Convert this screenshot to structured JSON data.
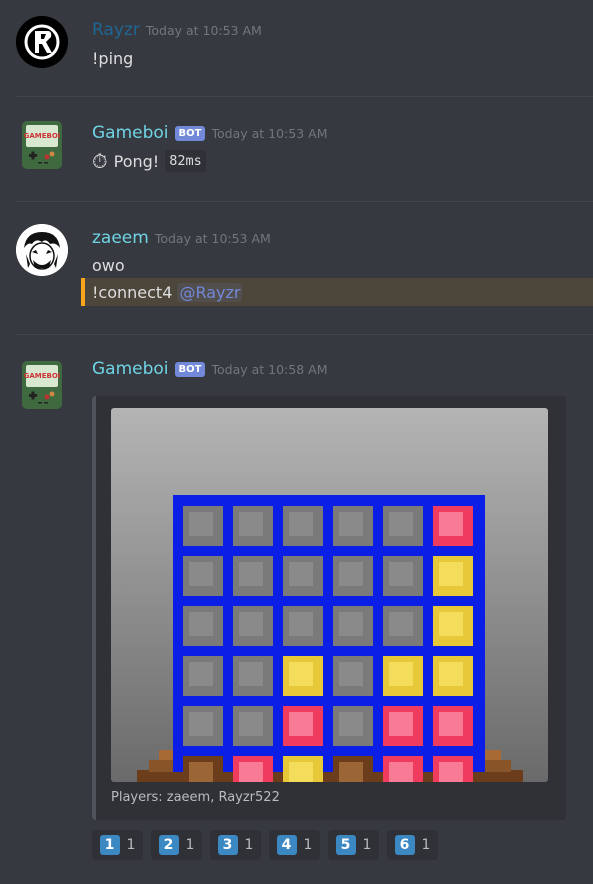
{
  "messages": [
    {
      "username": "Rayzr",
      "username_color": "#206694",
      "timestamp": "Today at 10:53 AM",
      "lines": [
        "!ping"
      ]
    },
    {
      "username": "Gameboi",
      "username_color": "#6fd4e5",
      "badge": "BOT",
      "timestamp": "Today at 10:53 AM",
      "pong_text": "Pong!",
      "pong_code": "82ms"
    },
    {
      "username": "zaeem",
      "username_color": "#6fd4e5",
      "timestamp": "Today at 10:53 AM",
      "line1": "owo",
      "line2": "!connect4",
      "mention": "@Rayzr"
    },
    {
      "username": "Gameboi",
      "username_color": "#6fd4e5",
      "badge": "BOT",
      "timestamp": "Today at 10:58 AM",
      "embed_footer": "Players: zaeem, Rayzr522"
    }
  ],
  "board": {
    "rows": [
      [
        "",
        "",
        "",
        "",
        "",
        "R"
      ],
      [
        "",
        "",
        "",
        "",
        "",
        "Y"
      ],
      [
        "",
        "",
        "",
        "",
        "",
        "Y"
      ],
      [
        "",
        "",
        "Y",
        "",
        "Y",
        "Y"
      ],
      [
        "",
        "",
        "R",
        "",
        "R",
        "R"
      ],
      [
        "W",
        "R",
        "Y",
        "W",
        "R",
        "R"
      ]
    ]
  },
  "reactions": [
    {
      "emoji": "1",
      "count": "1"
    },
    {
      "emoji": "2",
      "count": "1"
    },
    {
      "emoji": "3",
      "count": "1"
    },
    {
      "emoji": "4",
      "count": "1"
    },
    {
      "emoji": "5",
      "count": "1"
    },
    {
      "emoji": "6",
      "count": "1"
    }
  ],
  "icons": {
    "stopwatch": "stopwatch-icon"
  },
  "colors": {
    "background": "#36393f",
    "mention_highlight": "#faa61a",
    "bot_badge": "#7289da",
    "board_blue": "#0a1ee6"
  }
}
